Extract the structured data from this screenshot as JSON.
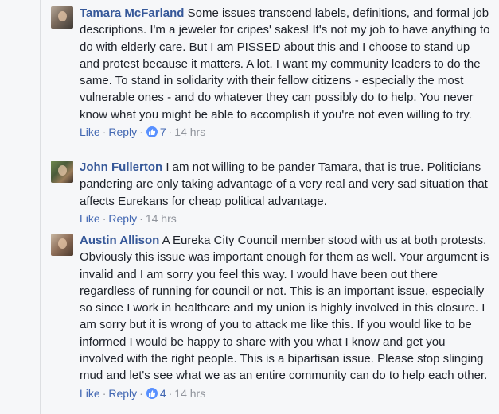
{
  "comments": [
    {
      "author": "Tamara McFarland",
      "text": "Some issues transcend labels, definitions, and formal job descriptions. I'm a jeweler for cripes' sakes! It's not my job to have anything to do with elderly care. But I am PISSED about this and I choose to stand up and protest because it matters. A lot. I want my community leaders to do the same. To stand in solidarity with their fellow citizens - especially the most vulnerable ones - and do whatever they can possibly do to help. You never know what you might be able to accomplish if you're not even willing to try.",
      "like_label": "Like",
      "reply_label": "Reply",
      "reaction_count": "7",
      "time": "14 hrs"
    },
    {
      "author": "John Fullerton",
      "text": "I am not willing to be pander Tamara, that is true. Politicians pandering are only taking advantage of a very real and very sad situation that affects Eurekans for cheap political advantage.",
      "like_label": "Like",
      "reply_label": "Reply",
      "time": "14 hrs"
    },
    {
      "author": "Austin Allison",
      "text": "A Eureka City Council member stood with us at both protests. Obviously this issue was important enough for them as well. Your argument is invalid and I am sorry you feel this way. I would have been out there regardless of running for council or not. This is an important issue, especially so since I work in healthcare and my union is highly involved in this closure. I am sorry but it is wrong of you to attack me like this. If you would like to be informed I would be happy to share with you what I know and get you involved with the right people. This is a bipartisan issue. Please stop slinging mud and let's see what we as an entire community can do to help each other.",
      "like_label": "Like",
      "reply_label": "Reply",
      "reaction_count": "4",
      "time": "14 hrs"
    }
  ],
  "icons": {
    "like_reaction": "thumbs-up-icon",
    "like_color": "#5890ff",
    "link_color": "#4267b2",
    "author_color": "#365899"
  }
}
